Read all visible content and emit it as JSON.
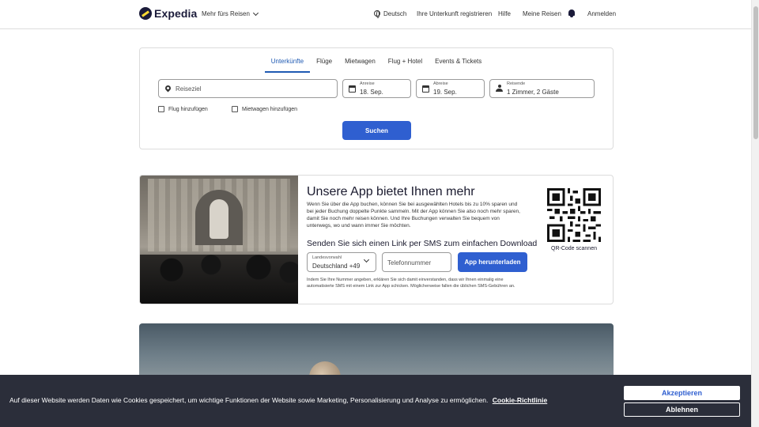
{
  "header": {
    "logo_text": "Expedia",
    "more_trips": "Mehr fürs Reisen",
    "language": "Deutsch",
    "register_property": "Ihre Unterkunft registrieren",
    "help": "Hilfe",
    "my_trips": "Meine Reisen",
    "sign_in": "Anmelden"
  },
  "search": {
    "tabs": [
      {
        "label": "Unterkünfte",
        "active": true
      },
      {
        "label": "Flüge",
        "active": false
      },
      {
        "label": "Mietwagen",
        "active": false
      },
      {
        "label": "Flug + Hotel",
        "active": false
      },
      {
        "label": "Events & Tickets",
        "active": false
      }
    ],
    "destination_placeholder": "Reiseziel",
    "checkin_label": "Anreise",
    "checkin_value": "18. Sep.",
    "checkout_label": "Abreise",
    "checkout_value": "19. Sep.",
    "travelers_label": "Reisende",
    "travelers_value": "1 Zimmer, 2 Gäste",
    "add_flight": "Flug hinzufügen",
    "add_car": "Mietwagen hinzufügen",
    "search_button": "Suchen"
  },
  "app_promo": {
    "title": "Unsere App bietet Ihnen mehr",
    "description": "Wenn Sie über die App buchen, können Sie bei ausgewählten Hotels bis zu 10% sparen und bei jeder Buchung doppelte Punkte sammeln. Mit der App können Sie also noch mehr sparen, damit Sie noch mehr reisen können. Und Ihre Buchungen verwalten Sie bequem von unterwegs, wo und wann immer Sie möchten.",
    "subtitle": "Senden Sie sich einen Link per SMS zum einfachen Download",
    "country_label": "Landesvorwahl",
    "country_value": "Deutschland +49",
    "phone_placeholder": "Telefonnummer",
    "download_button": "App herunterladen",
    "legal": "Indem Sie Ihre Nummer angeben, erklären Sie sich damit einverstanden, dass wir Ihnen einmalig eine automatisierte SMS mit einem Link zur App schicken. Möglicherweise fallen die üblichen SMS-Gebühren an.",
    "qr_label": "QR-Code scannen"
  },
  "cookie": {
    "text": "Auf dieser Website werden Daten wie Cookies gespeichert, um wichtige Funktionen der Website sowie Marketing, Personalisierung und Analyse zu ermöglichen.",
    "link": "Cookie-Richtlinie",
    "accept": "Akzeptieren",
    "decline": "Ablehnen"
  },
  "colors": {
    "primary": "#2f5fd0",
    "tab_active": "#1f5ab3",
    "cookie_bg": "#2b2e3a"
  }
}
